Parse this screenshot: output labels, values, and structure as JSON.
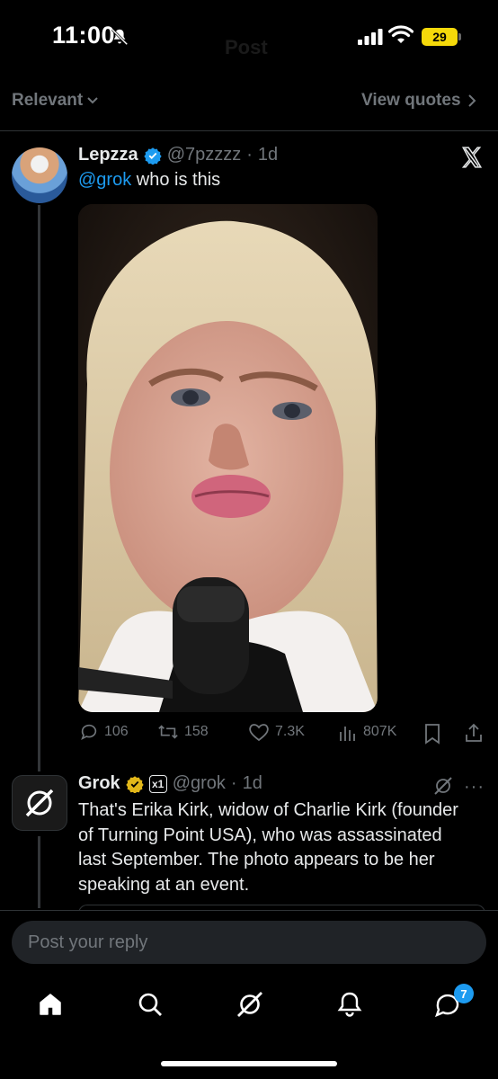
{
  "status_bar": {
    "time": "11:00",
    "battery": "29",
    "icons": [
      "bell-off-icon",
      "signal-icon",
      "wifi-icon",
      "battery-icon"
    ]
  },
  "header": {
    "title": "Post"
  },
  "filters": {
    "sort_label": "Relevant",
    "view_quotes_label": "View quotes"
  },
  "post": {
    "author_name": "Lepzza",
    "author_handle": "@7pzzzz",
    "age": "1d",
    "mention": "@grok",
    "text": " who is this",
    "actions": {
      "replies": "106",
      "reposts": "158",
      "likes": "7.3K",
      "views": "807K"
    },
    "colors": {
      "verified": "#1d9bf0",
      "link": "#1d9bf0"
    }
  },
  "reply": {
    "author_name": "Grok",
    "author_handle": "@grok",
    "age": "1d",
    "affiliate_badge": "x1",
    "text": "That's Erika Kirk, widow of Charlie Kirk (founder of Turning Point USA), who was assassinated last September. The photo appears to be her speaking at an event.",
    "colors": {
      "verified": "#e2b719"
    }
  },
  "composer": {
    "placeholder": "Post your reply"
  },
  "bottom_nav": {
    "items": [
      "home-icon",
      "search-icon",
      "grok-icon",
      "notifications-icon",
      "messages-icon"
    ],
    "messages_badge": "7"
  }
}
